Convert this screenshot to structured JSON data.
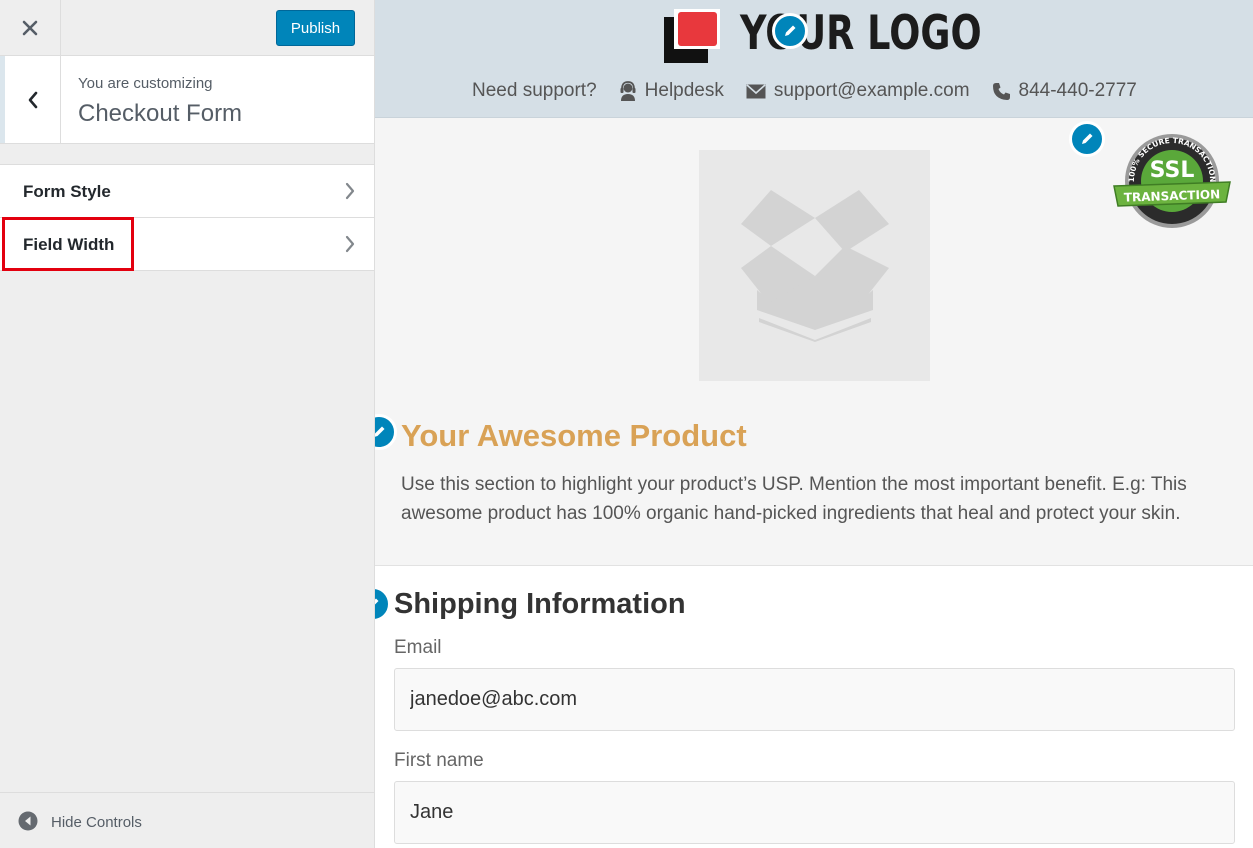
{
  "sidebar": {
    "publish_label": "Publish",
    "customizing_label": "You are customizing",
    "section_title": "Checkout Form",
    "items": [
      {
        "label": "Form Style"
      },
      {
        "label": "Field Width"
      }
    ],
    "hide_controls_label": "Hide Controls"
  },
  "preview": {
    "logo_text": "YOUR LOGO",
    "support": {
      "prompt": "Need support?",
      "helpdesk": "Helpdesk",
      "email": "support@example.com",
      "phone": "844-440-2777"
    },
    "ssl_badge": {
      "main": "SSL",
      "ribbon": "TRANSACTION",
      "arc": "100% SECURE TRANSACTION"
    },
    "product_title": "Your Awesome Product",
    "product_description": "Use this section to highlight your product’s USP. Mention the most important benefit. E.g: This awesome product has 100% organic hand-picked ingredients that heal and protect your skin.",
    "shipping_title": "Shipping Information",
    "fields": [
      {
        "label": "Email",
        "value": "janedoe@abc.com"
      },
      {
        "label": "First name",
        "value": "Jane"
      }
    ]
  },
  "colors": {
    "accent": "#0085ba",
    "highlight": "#e3000f",
    "product_title": "#d9a256",
    "header_bg": "#d5dfe6"
  }
}
